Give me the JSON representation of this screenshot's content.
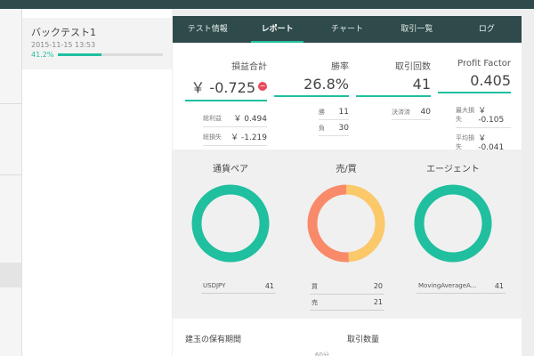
{
  "backtest": {
    "title": "バックテスト1",
    "date": "2015-11-15 13:53",
    "progress_label": "41.2%",
    "progress_fraction": 0.412
  },
  "tabs": [
    {
      "label": "テスト情報",
      "active": false
    },
    {
      "label": "レポート",
      "active": true
    },
    {
      "label": "チャート",
      "active": false
    },
    {
      "label": "取引一覧",
      "active": false
    },
    {
      "label": "ログ",
      "active": false
    }
  ],
  "stats": {
    "profit": {
      "label": "損益合計",
      "value": "￥ -0.725",
      "rows": [
        {
          "k": "総利益",
          "v": "￥ 0.494"
        },
        {
          "k": "総損失",
          "v": "￥ -1.219"
        }
      ]
    },
    "win_rate": {
      "label": "勝率",
      "value": "26.8%",
      "rows": [
        {
          "k": "勝",
          "v": "11"
        },
        {
          "k": "負",
          "v": "30"
        }
      ]
    },
    "trades": {
      "label": "取引回数",
      "value": "41",
      "rows": [
        {
          "k": "決済済",
          "v": "40"
        }
      ]
    },
    "profit_factor": {
      "label": "Profit Factor",
      "value": "0.405",
      "rows": [
        {
          "k": "最大損失",
          "v": "￥ -0.105"
        },
        {
          "k": "平均損失",
          "v": "￥ -0.041"
        }
      ]
    }
  },
  "colors": {
    "accent": "#1fbf9f",
    "header": "#2e4a4a",
    "buy": "#fbc86a",
    "sell": "#f88a6a",
    "negative": "#e84a5f"
  },
  "chart_data": [
    {
      "type": "pie",
      "title": "通貨ペア",
      "categories": [
        "USDJPY"
      ],
      "values": [
        41
      ]
    },
    {
      "type": "pie",
      "title": "売/買",
      "categories": [
        "買",
        "売"
      ],
      "values": [
        20,
        21
      ]
    },
    {
      "type": "pie",
      "title": "エージェント",
      "categories": [
        "MovingAverageA..."
      ],
      "values": [
        41
      ]
    }
  ],
  "bottom": {
    "left_title": "建玉の保有期間",
    "right_title": "取引数量",
    "faint_value": "60分"
  }
}
